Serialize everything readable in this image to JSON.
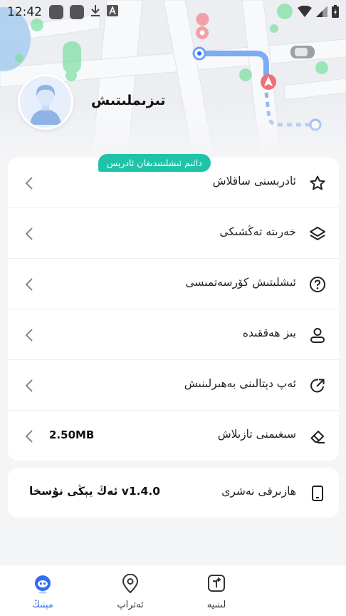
{
  "status_bar": {
    "time": "12:42",
    "icons": [
      "app-square-icon",
      "app-square-icon",
      "download-icon",
      "translate-icon",
      "wifi-icon",
      "signal-icon",
      "battery-charging-icon"
    ]
  },
  "profile": {
    "username": "تىزىملىتىش",
    "avatar_icon": "user-avatar-icon"
  },
  "menu": {
    "items": [
      {
        "label": "ئادرېسنى ساقلاش",
        "icon": "star-icon",
        "badge": "دائىم ئىشلىتىدىغان ئادرېس"
      },
      {
        "label": "خەرىتە تەڭشىكى",
        "icon": "layers-icon"
      },
      {
        "label": "ئىشلىتىش كۆرسەتمىسى",
        "icon": "help-circle-icon"
      },
      {
        "label": "بىز ھەققىدە",
        "icon": "person-icon"
      },
      {
        "label": "ئەپ دېتالىنى بەھىرلىنىش",
        "icon": "share-icon"
      },
      {
        "label": "سىغىمنى تازىلاش",
        "icon": "eraser-icon",
        "value": "2.50MB"
      }
    ]
  },
  "about": {
    "label": "ھازىرقى نەشرى",
    "icon": "phone-icon",
    "version": "v1.4.0 ئەڭ يېڭى نۇسخا"
  },
  "bottom_nav": {
    "items": [
      {
        "label": "مېنىڭ",
        "icon": "profile-tab-icon",
        "active": true
      },
      {
        "label": "ئەتراپ",
        "icon": "location-pin-icon",
        "active": false
      },
      {
        "label": "لىنىيە",
        "icon": "route-icon",
        "active": false
      }
    ]
  },
  "colors": {
    "accent": "#2f6ef3",
    "badge": "#1fc3a7",
    "route": "#6ea3f0",
    "map_green": "#7be0a0",
    "marker_red": "#f0707a"
  }
}
